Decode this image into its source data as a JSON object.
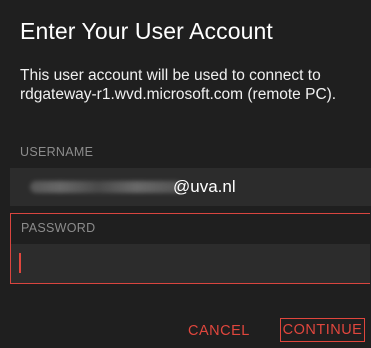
{
  "dialog": {
    "title": "Enter Your User Account",
    "message": "This user account will be used to connect to rdgateway-r1.wvd.microsoft.com (remote PC)."
  },
  "username": {
    "label": "USERNAME",
    "value_suffix": "@uva.nl"
  },
  "password": {
    "label": "PASSWORD",
    "value": ""
  },
  "buttons": {
    "cancel": "CANCEL",
    "continue": "CONTINUE"
  },
  "colors": {
    "background": "#1f1f1f",
    "field_background": "#2c2c2c",
    "accent": "#e0463d",
    "label": "#8c8c8c",
    "text": "#ffffff"
  }
}
